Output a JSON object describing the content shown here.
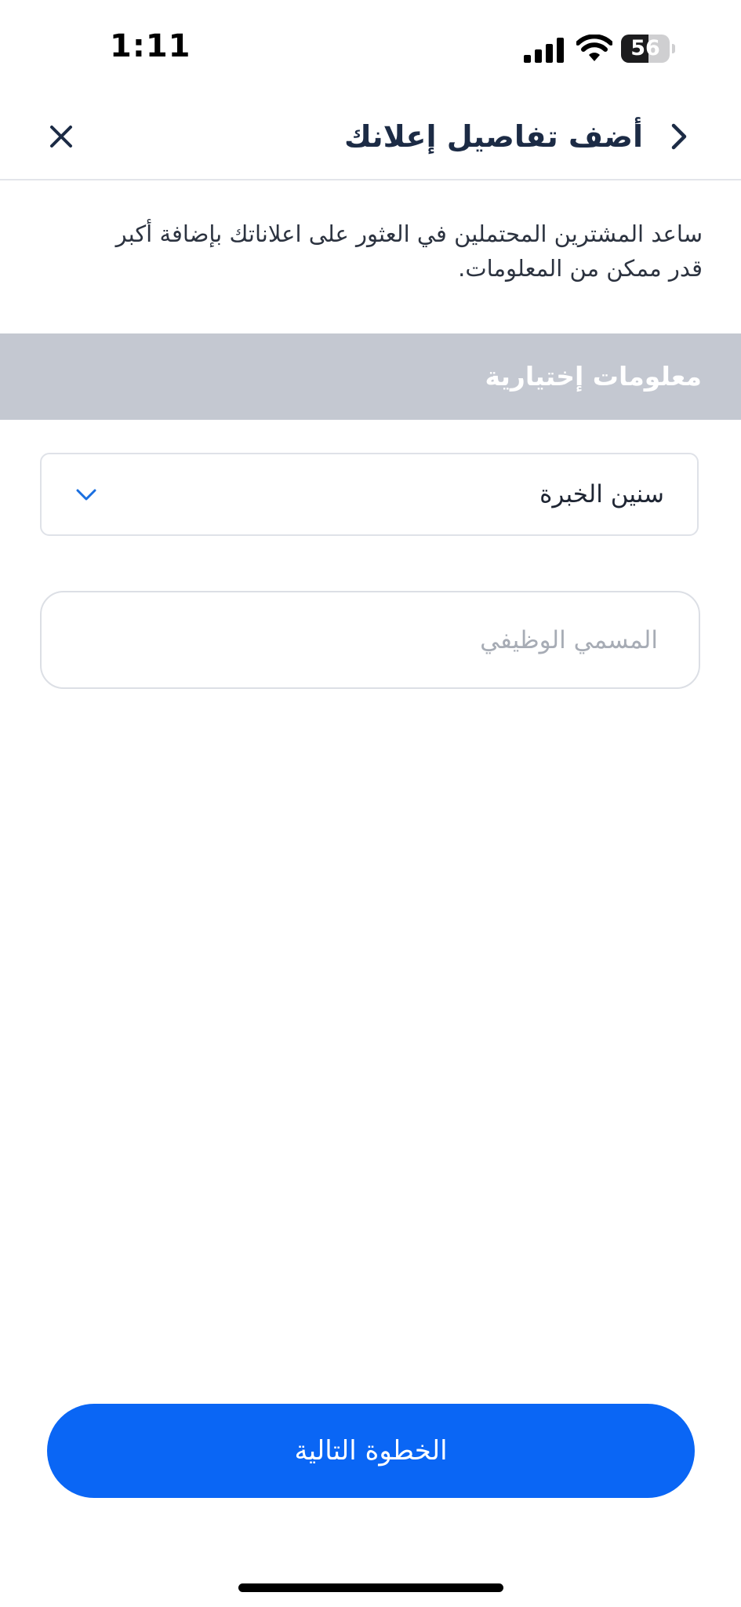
{
  "status_bar": {
    "time": "1:11",
    "battery_level": "56",
    "battery_fraction": 0.56,
    "icons": [
      "signal-icon",
      "wifi-icon",
      "battery-icon"
    ]
  },
  "header": {
    "title": "أضف تفاصيل إعلانك",
    "back_icon": "chevron-right-icon",
    "close_icon": "close-icon"
  },
  "description": "ساعد المشترين المحتملين في العثور على اعلاناتك بإضافة أكبر قدر ممكن من المعلومات.",
  "section": {
    "title": "معلومات إختيارية"
  },
  "form": {
    "experience_dropdown": {
      "label": "سنين الخبرة",
      "icon": "chevron-down-icon"
    },
    "job_title_input": {
      "placeholder": "المسمي الوظيفي",
      "value": ""
    }
  },
  "footer": {
    "next_label": "الخطوة التالية"
  },
  "colors": {
    "primary": "#0a66f5",
    "section_bg": "#c4c8d1",
    "title": "#1c2b45",
    "dropdown_chevron": "#1a6fe0"
  }
}
